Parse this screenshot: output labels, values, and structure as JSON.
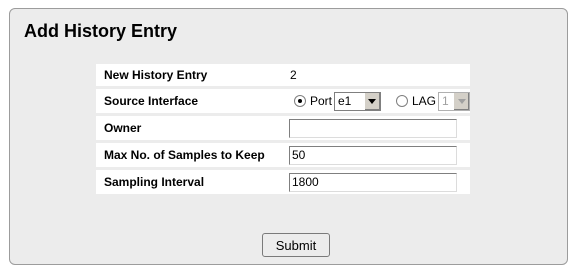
{
  "page": {
    "title": "Add History Entry"
  },
  "form": {
    "new_history_entry": {
      "label": "New History Entry",
      "value": "2"
    },
    "source_interface": {
      "label": "Source Interface",
      "port_label": "Port",
      "port_selected": true,
      "port_value": "e1",
      "lag_label": "LAG",
      "lag_selected": false,
      "lag_value": "1"
    },
    "owner": {
      "label": "Owner",
      "value": ""
    },
    "max_samples": {
      "label": "Max No. of Samples to Keep",
      "value": "50"
    },
    "sampling_interval": {
      "label": "Sampling Interval",
      "value": "1800"
    }
  },
  "actions": {
    "submit_label": "Submit"
  },
  "icons": {
    "dropdown": "chevron-down-icon"
  }
}
